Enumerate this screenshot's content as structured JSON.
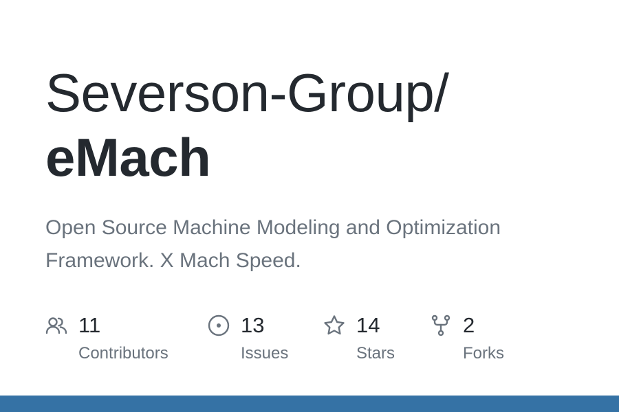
{
  "repo": {
    "owner": "Severson-Group/",
    "name": "eMach",
    "description": "Open Source Machine Modeling and Optimization Framework. X Mach Speed."
  },
  "stats": {
    "contributors": {
      "value": "11",
      "label": "Contributors",
      "icon": "people-icon"
    },
    "issues": {
      "value": "13",
      "label": "Issues",
      "icon": "issue-opened-icon"
    },
    "stars": {
      "value": "14",
      "label": "Stars",
      "icon": "star-icon"
    },
    "forks": {
      "value": "2",
      "label": "Forks",
      "icon": "repo-forked-icon"
    }
  },
  "colors": {
    "text": "#24292f",
    "muted": "#6a737d",
    "language_bar": "#3572a5"
  }
}
